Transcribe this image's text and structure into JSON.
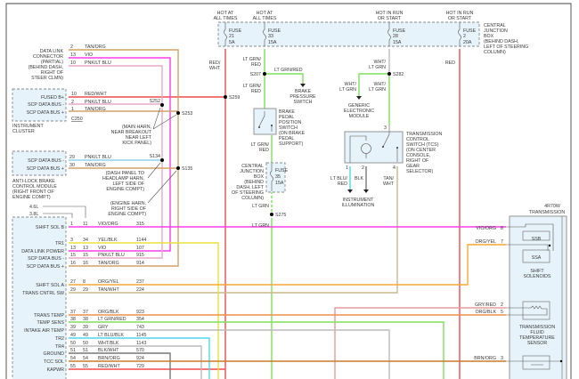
{
  "colors": {
    "red": "#f24b4b",
    "green": "#7ee05a",
    "magenta": "#f53ee6",
    "tan": "#d4a26a",
    "pink": "#e8a9c8",
    "ltblue": "#8fd0ee",
    "yellow": "#e8e23c",
    "orange": "#f7a832",
    "cyan": "#4fd6ee",
    "gray": "#bbbbbb",
    "dkgray": "#777777",
    "brnorg": "#c77a2a",
    "panel": "#e6f3fa"
  },
  "fuses": [
    {
      "hot": [
        "HOT AT",
        "ALL TIMES"
      ],
      "label": "FUSE",
      "number": "21",
      "rating": "5A"
    },
    {
      "hot": [
        "HOT AT",
        "ALL TIMES"
      ],
      "label": "FUSE",
      "number": "33",
      "rating": "15A"
    },
    {
      "hot": [
        "HOT IN RUN",
        "OR START"
      ],
      "label": "FUSE",
      "number": "28",
      "rating": "15A"
    },
    {
      "hot": [
        "HOT IN RUN",
        "OR START"
      ],
      "label": "FUSE",
      "number": "2",
      "rating": "20A"
    }
  ],
  "cjb": [
    "CENTRAL",
    "JUNCTION",
    "BOX",
    "(BEHIND DASH,",
    "LEFT OF STEERING",
    "COLUMN)"
  ],
  "cjb2": {
    "lines": [
      "CENTRAL",
      "JUNCTION",
      "BOX",
      "(BEHIND",
      "DASH, LEFT",
      "OF STEERING",
      "COLUMN)"
    ],
    "label": "FUSE",
    "number": "35",
    "rating": "15A"
  },
  "dlc": {
    "lines": [
      "DATA LINK",
      "CONNECTOR",
      "(PARTIAL)",
      "(BEHIND DASH,",
      "RIGHT OF",
      "STEER CLMN)"
    ],
    "pins": [
      {
        "pin": "2",
        "color": "TAN/ORG"
      },
      {
        "pin": "13",
        "color": "VIO"
      },
      {
        "pin": "10",
        "color": "PNK/LT BLU"
      }
    ]
  },
  "cluster": {
    "name": "INSTRUMENT CLUSTER",
    "name_lines": [
      "INSTRUMENT",
      "CLUSTER"
    ],
    "connector": "C250",
    "pins": [
      {
        "func": "FUSED B+",
        "pin": "10",
        "color": "RED/WHT"
      },
      {
        "func": "SCP DATA BUS -",
        "pin": "2",
        "color": "PNK/LT BLU"
      },
      {
        "func": "SCP DATA BUS +",
        "pin": "1",
        "color": "TAN/ORG"
      }
    ]
  },
  "abs": {
    "lines": [
      "ANTI-LOCK BRAKE",
      "CONTROL MODULE",
      "(RIGHT FRONT OF",
      "ENGINE COMPT)"
    ],
    "pins": [
      {
        "func": "SCP DATA BUS -",
        "pin": "29",
        "color": "PNK/LT BLU"
      },
      {
        "func": "SCP DATA BUS +",
        "pin": "30",
        "color": "TAN/ORG"
      }
    ]
  },
  "splices": {
    "s259": "S259",
    "s207": "S207",
    "s282": "S282",
    "s252": "S252",
    "s253": "S253",
    "s134": "S134",
    "s135": "S135",
    "s275": "S275"
  },
  "notes": {
    "main_harness": [
      "(MAIN HARN,",
      "NEAR BREAKOUT",
      "NEAR LEFT",
      "KICK PANEL)"
    ],
    "dash_panel": [
      "(DASH PANEL TO",
      "HEADLAMP HARN,",
      "LEFT SIDE OF",
      "ENGINE COMPT)"
    ],
    "engine_harness": [
      "(ENGINE HARN,",
      "RIGHT SIDE OF",
      "ENGINE COMPT)"
    ]
  },
  "wire_labels": {
    "red_wht": [
      "RED/",
      "WHT"
    ],
    "ltgrn_red1": [
      "LT GRN/",
      "RED"
    ],
    "ltgrn_red_branch": "LT GRN/RED",
    "ltgrn_red2": [
      "LT GRN/",
      "RED"
    ],
    "ltgrn_red3": [
      "LT GRN/",
      "RED"
    ],
    "lt_grn1": "LT GRN",
    "lt_grn2": "LT GRN",
    "wht_ltgrn1": [
      "WHT/",
      "LT GRN"
    ],
    "wht_ltgrn2": [
      "WHT/",
      "LT GRN"
    ],
    "wht_ltgrn3": [
      "WHT/",
      "LT GRN"
    ],
    "red": "RED",
    "ltblu_red": [
      "LT BLU/",
      "RED"
    ],
    "blk": "BLK",
    "tan_wht": [
      "TAN/",
      "WHT"
    ]
  },
  "components": {
    "brake_pressure": [
      "BRAKE",
      "PRESSURE",
      "SWITCH"
    ],
    "brake_pedal": [
      "BRAKE",
      "PEDAL",
      "POSITION",
      "SWITCH",
      "(ON BRAKE",
      "PEDAL",
      "SUPPORT)"
    ],
    "gem": [
      "GENERIC",
      "ELECTRONIC",
      "MODULE"
    ],
    "tcs": [
      "TRANSMISSION",
      "CONTROL",
      "SWITCH (TCS)",
      "(ON CENTER",
      "CONSOLE,",
      "RIGHT OF",
      "GEAR",
      "SELECTOR)"
    ],
    "tcs_pins": [
      "3",
      "1",
      "2",
      "4"
    ],
    "illum": [
      "INSTRUMENT",
      "ILLUMINATION"
    ]
  },
  "engine_variants": [
    "4.6L",
    "3.8L"
  ],
  "pcm_rows": [
    {
      "func": "SHIFT SOL B",
      "p1": "1",
      "p2": "11",
      "color": "VIO/ORG",
      "circuit": "315"
    },
    {
      "func": "TR1",
      "p1": "3",
      "p2": "34",
      "color": "YEL/BLK",
      "circuit": "1144"
    },
    {
      "func": "DATA LINK POWER",
      "p1": "13",
      "p2": "13",
      "color": "VIO",
      "circuit": "107"
    },
    {
      "func": "SCP DATA BUS -",
      "p1": "15",
      "p2": "15",
      "color": "PNK/LT BLU",
      "circuit": "915"
    },
    {
      "func": "SCP DATA BUS +",
      "p1": "16",
      "p2": "16",
      "color": "TAN/ORG",
      "circuit": "914"
    },
    {
      "func": "SHIFT SOL A",
      "p1": "27",
      "p2": "8",
      "color": "ORG/YEL",
      "circuit": "237"
    },
    {
      "func": "TRANS CNTRL SW",
      "p1": "29",
      "p2": "29",
      "color": "TAN/WHT",
      "circuit": "224"
    },
    {
      "func": "TRANS TEMP",
      "p1": "37",
      "p2": "37",
      "color": "ORG/BLK",
      "circuit": "923"
    },
    {
      "func": "TEMP SENS",
      "p1": "38",
      "p2": "38",
      "color": "LT GRN/RED",
      "circuit": "354"
    },
    {
      "func": "INTAKE AIR TEMP",
      "p1": "39",
      "p2": "39",
      "color": "GRY",
      "circuit": "743"
    },
    {
      "func": "TR2",
      "p1": "49",
      "p2": "49",
      "color": "LT BLU/BLK",
      "circuit": "1145"
    },
    {
      "func": "TR4",
      "p1": "50",
      "p2": "50",
      "color": "WHT/BLK",
      "circuit": "1143"
    },
    {
      "func": "GROUND",
      "p1": "51",
      "p2": "51",
      "color": "BLK/WHT",
      "circuit": "570"
    },
    {
      "func": "TCC SOL",
      "p1": "54",
      "p2": "54",
      "color": "BRN/ORG",
      "circuit": "924"
    },
    {
      "func": "KAPWR",
      "p1": "55",
      "p2": "55",
      "color": "RED/WHT",
      "circuit": "729"
    }
  ],
  "transmission": {
    "title": [
      "4R70W",
      "TRANSMISSION"
    ],
    "pins": [
      {
        "color": "VIO/ORG",
        "pin": "8"
      },
      {
        "color": "ORG/YEL",
        "pin": "7"
      },
      {
        "color": "GRY/RED",
        "pin": "2"
      },
      {
        "color": "ORG/BLK",
        "pin": "5"
      },
      {
        "color": "BRN/ORG",
        "pin": "3"
      }
    ],
    "ssb": "SSB",
    "ssa": "SSA",
    "solenoids": [
      "SHIFT",
      "SOLENOIDS"
    ],
    "tft": [
      "TRANSMISSION",
      "FLUID",
      "TEMPERATURE",
      "SENSOR"
    ]
  }
}
